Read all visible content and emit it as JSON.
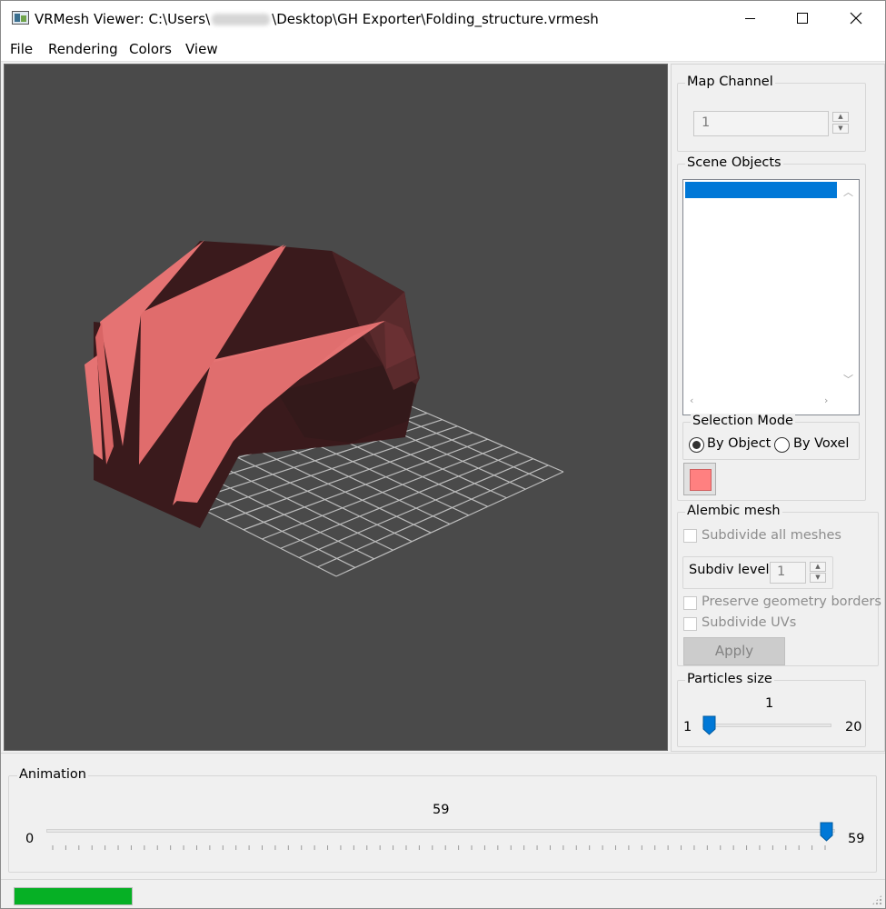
{
  "window": {
    "title_prefix": "VRMesh Viewer: C:\\Users\\",
    "title_suffix": "\\Desktop\\GH Exporter\\Folding_structure.vrmesh"
  },
  "menu": {
    "items": [
      "File",
      "Rendering",
      "Colors",
      "View"
    ]
  },
  "viewport": {
    "background": "#4a4a4a",
    "mesh_colors": {
      "light": "#e57373",
      "dark": "#3a1a1c"
    },
    "grid_color": "#bdbdbd"
  },
  "panel": {
    "map_channel": {
      "label": "Map Channel",
      "value": "1"
    },
    "scene_objects": {
      "label": "Scene Objects"
    },
    "selection_mode": {
      "label": "Selection Mode",
      "options": [
        "By Object",
        "By Voxel"
      ],
      "selected": "By Object"
    },
    "object_color": "#ff8080",
    "alembic": {
      "label": "Alembic mesh",
      "subdivide_all": "Subdivide all meshes",
      "subdiv_level_label": "Subdiv level",
      "subdiv_level_value": "1",
      "preserve_borders": "Preserve geometry borders",
      "subdivide_uvs": "Subdivide UVs",
      "apply": "Apply"
    },
    "particles": {
      "label": "Particles size",
      "value": "1",
      "min": "1",
      "max": "20",
      "fraction": 0
    }
  },
  "animation": {
    "label": "Animation",
    "value": "59",
    "min": "0",
    "max": "59",
    "fraction": 1
  },
  "status": {
    "progress_fraction": 1,
    "progress_color": "#06b025"
  }
}
